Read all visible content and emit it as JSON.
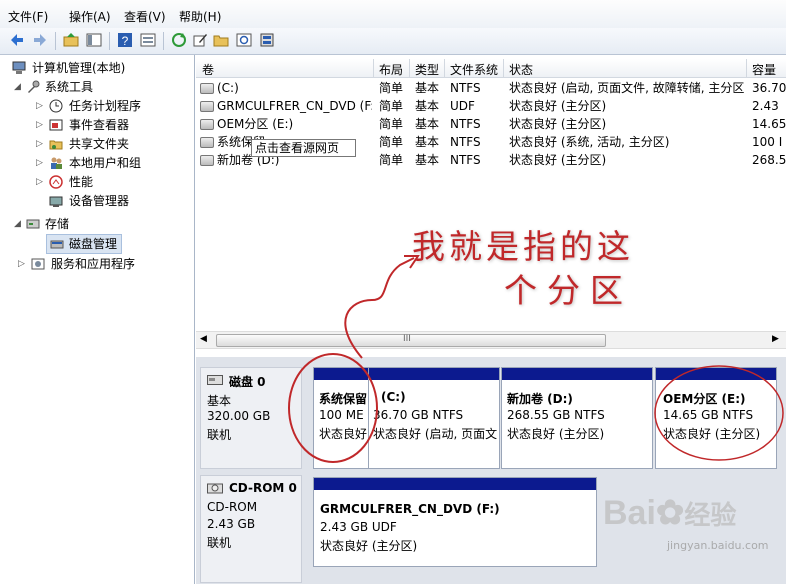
{
  "menu": [
    "文件(F)",
    "操作(A)",
    "查看(V)",
    "帮助(H)"
  ],
  "tree": {
    "root": "计算机管理(本地)",
    "system_tools": "系统工具",
    "task_scheduler": "任务计划程序",
    "event_viewer": "事件查看器",
    "shared_folders": "共享文件夹",
    "local_users": "本地用户和组",
    "performance": "性能",
    "device_manager": "设备管理器",
    "storage": "存储",
    "disk_management": "磁盘管理",
    "services_apps": "服务和应用程序"
  },
  "columns": [
    "卷",
    "布局",
    "类型",
    "文件系统",
    "状态",
    "容量"
  ],
  "volumes": [
    {
      "name": "(C:)",
      "layout": "简单",
      "type": "基本",
      "fs": "NTFS",
      "status": "状态良好 (启动, 页面文件, 故障转储, 主分区)",
      "size": "36.70"
    },
    {
      "name": "GRMCULFRER_CN_DVD (F:)",
      "layout": "简单",
      "type": "基本",
      "fs": "UDF",
      "status": "状态良好 (主分区)",
      "size": "2.43"
    },
    {
      "name": "OEM分区 (E:)",
      "layout": "简单",
      "type": "基本",
      "fs": "NTFS",
      "status": "状态良好 (主分区)",
      "size": "14.65"
    },
    {
      "name": "系统保留",
      "layout": "简单",
      "type": "基本",
      "fs": "NTFS",
      "status": "状态良好 (系统, 活动, 主分区)",
      "size": "100 I"
    },
    {
      "name": "新加卷 (D:)",
      "layout": "简单",
      "type": "基本",
      "fs": "NTFS",
      "status": "状态良好 (主分区)",
      "size": "268.5"
    }
  ],
  "tooltip": "点击查看源网页",
  "scroll_grip": "III",
  "disk0": {
    "name": "磁盘 0",
    "type": "基本",
    "size": "320.00 GB",
    "state": "联机",
    "partitions": [
      {
        "title": "系统保留",
        "line2": "100 ME",
        "line3": "状态良好"
      },
      {
        "title": "(C:)",
        "line2": "36.70 GB NTFS",
        "line3": "状态良好 (启动, 页面文"
      },
      {
        "title": "新加卷  (D:)",
        "line2": "268.55 GB NTFS",
        "line3": "状态良好 (主分区)"
      },
      {
        "title": "OEM分区  (E:)",
        "line2": "14.65 GB NTFS",
        "line3": "状态良好 (主分区)"
      }
    ]
  },
  "cdrom0": {
    "name": "CD-ROM 0",
    "type": "CD-ROM",
    "size": "2.43 GB",
    "state": "联机",
    "partition": {
      "title": "GRMCULFRER_CN_DVD  (F:)",
      "line2": "2.43 GB UDF",
      "line3": "状态良好 (主分区)"
    }
  },
  "annotation": {
    "line1": "我就是指的这",
    "line2": "个分区",
    "color": "#c0282a"
  },
  "watermark": {
    "brand": "Bai",
    "brand2": "经验",
    "url": "jingyan.baidu.com"
  },
  "colors": {
    "partition_bar": "#0c1a8f",
    "annotation": "#c0282a"
  }
}
